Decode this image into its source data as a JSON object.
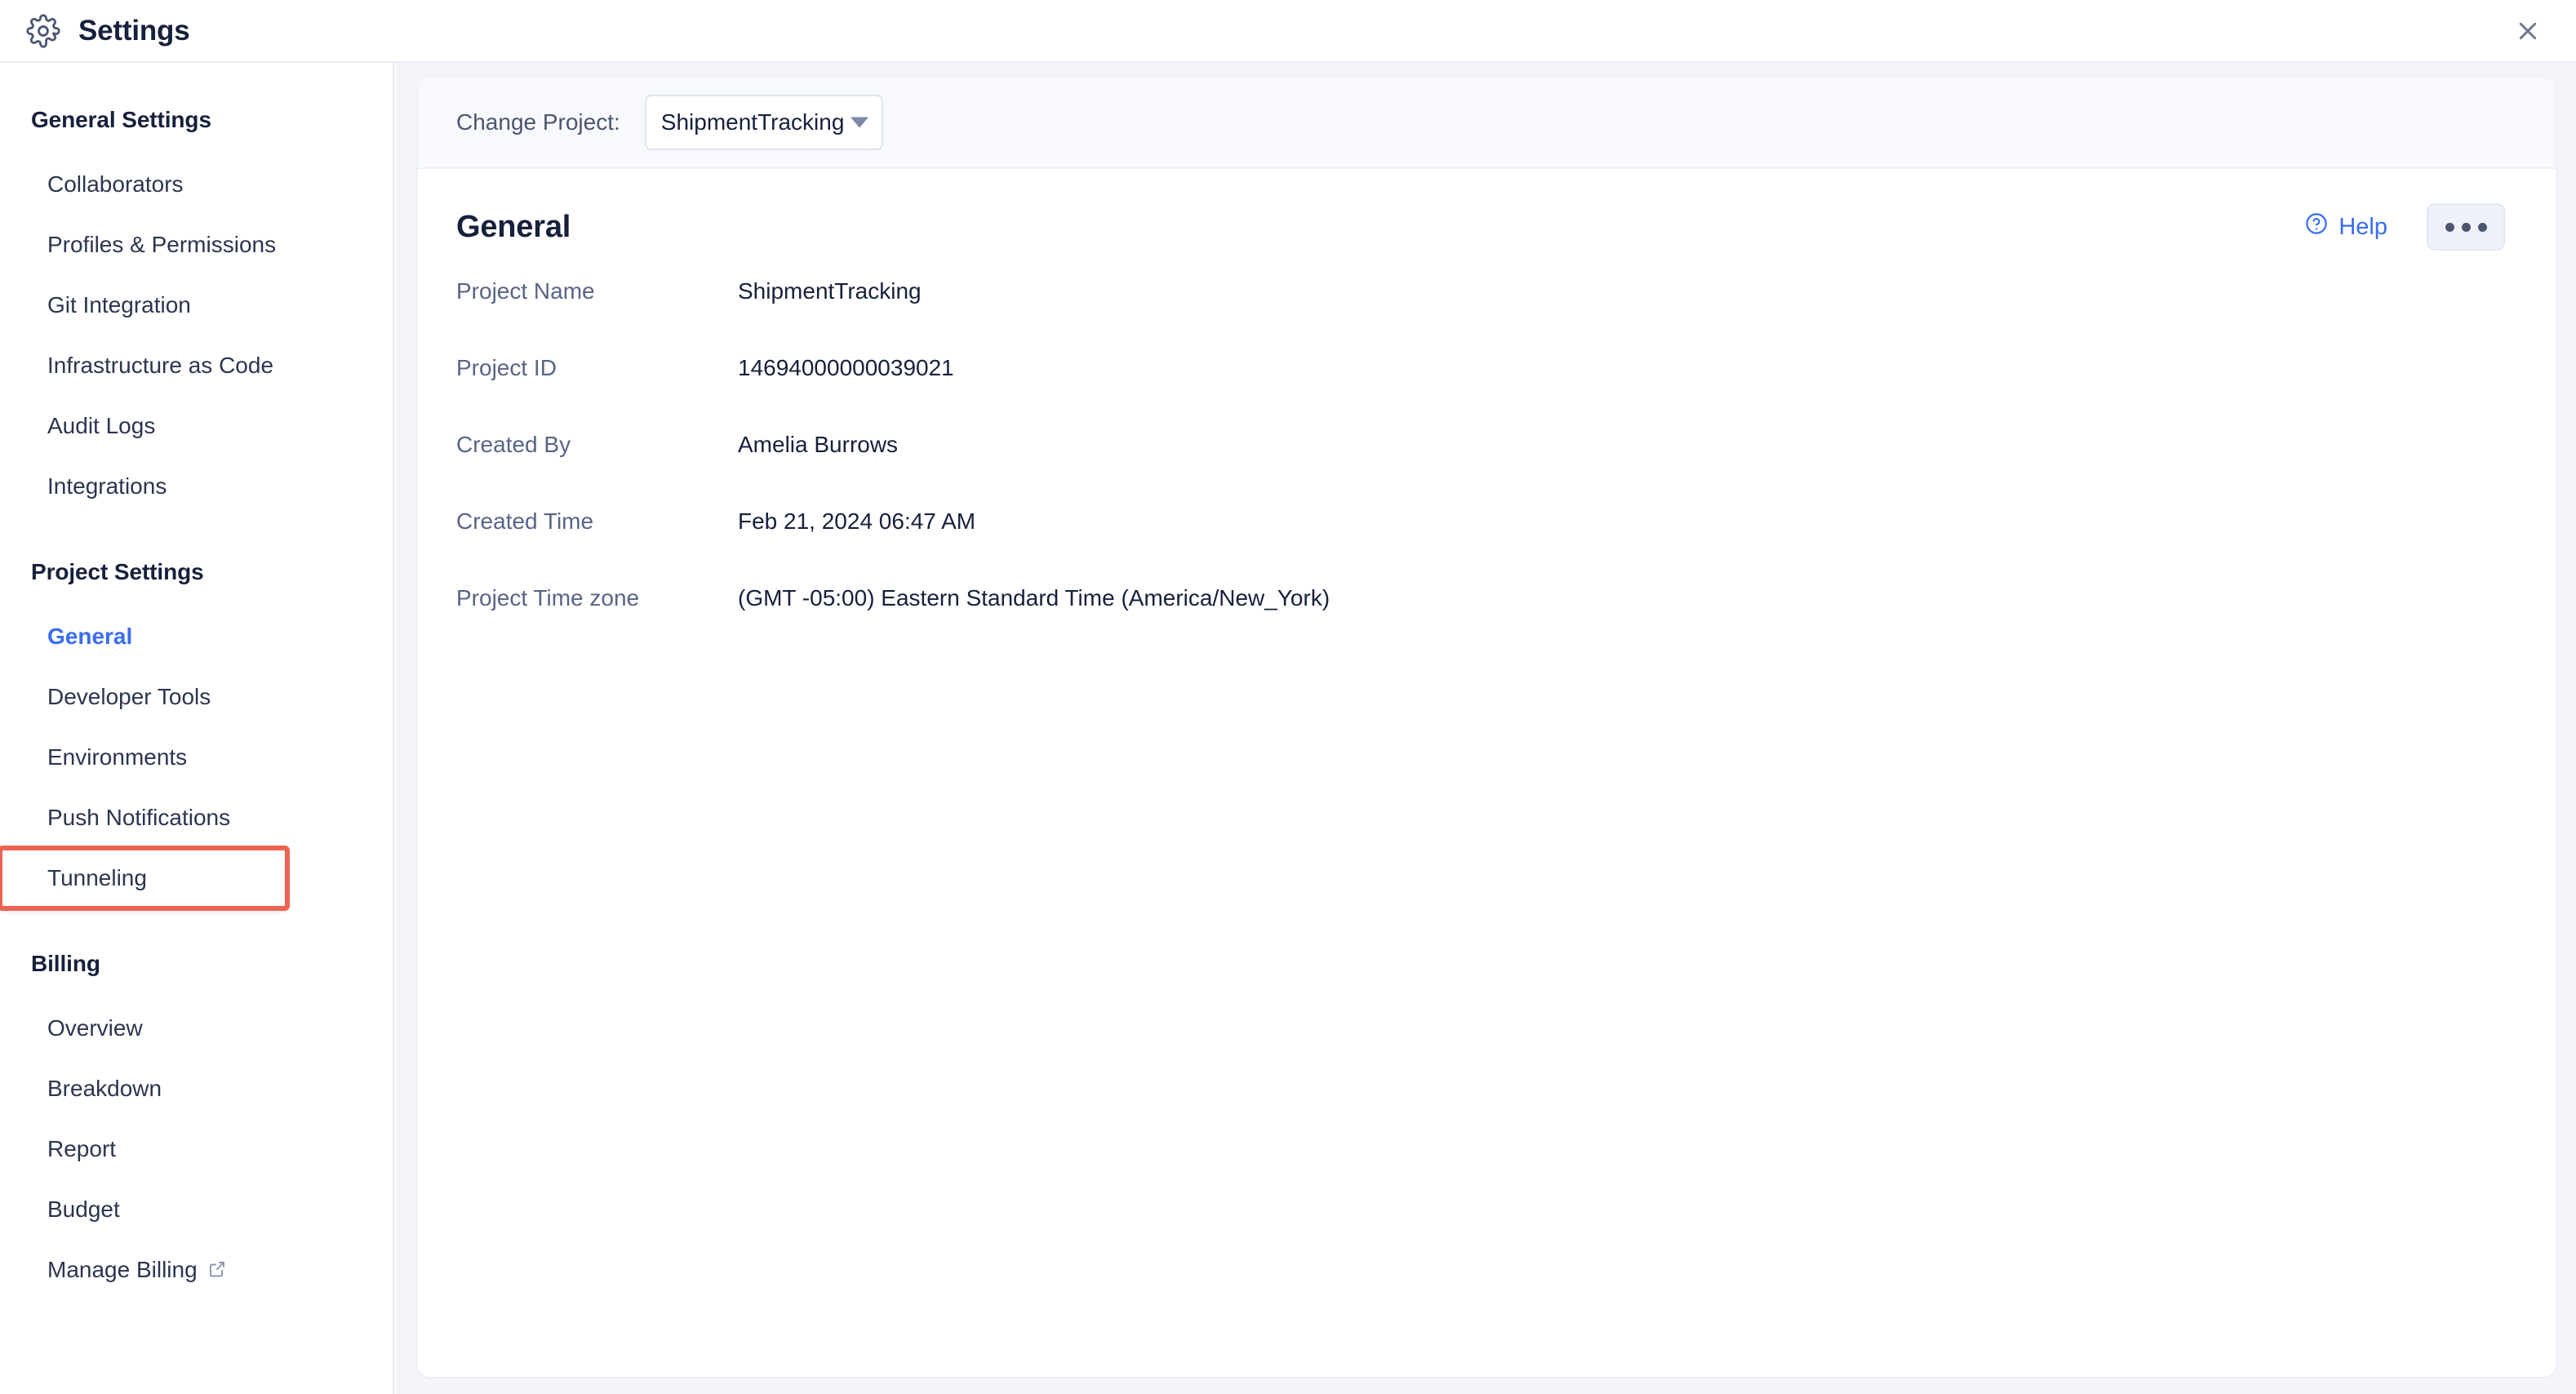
{
  "header": {
    "title": "Settings",
    "gear_icon": "gear-icon",
    "close_icon": "close-icon"
  },
  "sidebar": {
    "groups": [
      {
        "title": "General Settings",
        "items": [
          {
            "label": "Collaborators",
            "state": "default"
          },
          {
            "label": "Profiles & Permissions",
            "state": "default"
          },
          {
            "label": "Git Integration",
            "state": "default"
          },
          {
            "label": "Infrastructure as Code",
            "state": "default"
          },
          {
            "label": "Audit Logs",
            "state": "default"
          },
          {
            "label": "Integrations",
            "state": "default"
          }
        ]
      },
      {
        "title": "Project Settings",
        "items": [
          {
            "label": "General",
            "state": "active"
          },
          {
            "label": "Developer Tools",
            "state": "default"
          },
          {
            "label": "Environments",
            "state": "default"
          },
          {
            "label": "Push Notifications",
            "state": "default"
          },
          {
            "label": "Tunneling",
            "state": "highlighted"
          }
        ]
      },
      {
        "title": "Billing",
        "items": [
          {
            "label": "Overview",
            "state": "default"
          },
          {
            "label": "Breakdown",
            "state": "default"
          },
          {
            "label": "Report",
            "state": "default"
          },
          {
            "label": "Budget",
            "state": "default"
          },
          {
            "label": "Manage Billing",
            "state": "default",
            "external": true,
            "external_icon": "external-link-icon"
          }
        ]
      }
    ]
  },
  "project_bar": {
    "label": "Change Project:",
    "selected_project": "ShipmentTracking",
    "caret_icon": "chevron-down-icon"
  },
  "panel": {
    "title": "General",
    "help_label": "Help",
    "help_icon": "question-circle-icon",
    "more_label": "More options",
    "more_icon": "ellipsis-icon",
    "rows": [
      {
        "label": "Project Name",
        "value": "ShipmentTracking"
      },
      {
        "label": "Project ID",
        "value": "14694000000039021"
      },
      {
        "label": "Created By",
        "value": "Amelia Burrows"
      },
      {
        "label": "Created Time",
        "value": "Feb 21, 2024 06:47 AM"
      },
      {
        "label": "Project Time zone",
        "value": "(GMT -05:00) Eastern Standard Time (America/New_York)"
      }
    ]
  },
  "colors": {
    "accent_blue": "#3a6df0",
    "highlight_red": "#ee6352",
    "text_dark": "#17203c",
    "text_muted": "#596486",
    "content_bg": "#f3f5fb",
    "bar_bg": "#f7f9fd"
  }
}
